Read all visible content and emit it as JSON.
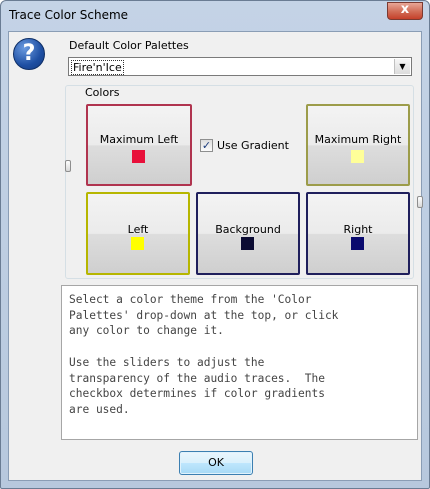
{
  "window": {
    "title": "Trace Color Scheme",
    "close_label": "x"
  },
  "icons": {
    "help": "question-mark-icon"
  },
  "palettes": {
    "group_label": "Default Color Palettes",
    "selected": "Fire'n'Ice"
  },
  "colors": {
    "group_label": "Colors",
    "use_gradient_label": "Use Gradient",
    "use_gradient_checked": true,
    "buttons": {
      "maximum_left": {
        "label": "Maximum Left",
        "color": "#e8103a",
        "border": "#b0344f"
      },
      "maximum_right": {
        "label": "Maximum Right",
        "color": "#ffff99",
        "border": "#9c9c4a"
      },
      "left": {
        "label": "Left",
        "color": "#ffff00",
        "border": "#b6b600"
      },
      "background": {
        "label": "Background",
        "color": "#0b0b33",
        "border": "#1f1f5c"
      },
      "right": {
        "label": "Right",
        "color": "#0a0a6e",
        "border": "#1f1f5c"
      }
    }
  },
  "info": {
    "text": "Select a color theme from the 'Color\nPalettes' drop-down at the top, or click\nany color to change it.\n\nUse the sliders to adjust the\ntransparency of the audio traces.  The\ncheckbox determines if color gradients\nare used."
  },
  "footer": {
    "ok_label": "OK"
  }
}
